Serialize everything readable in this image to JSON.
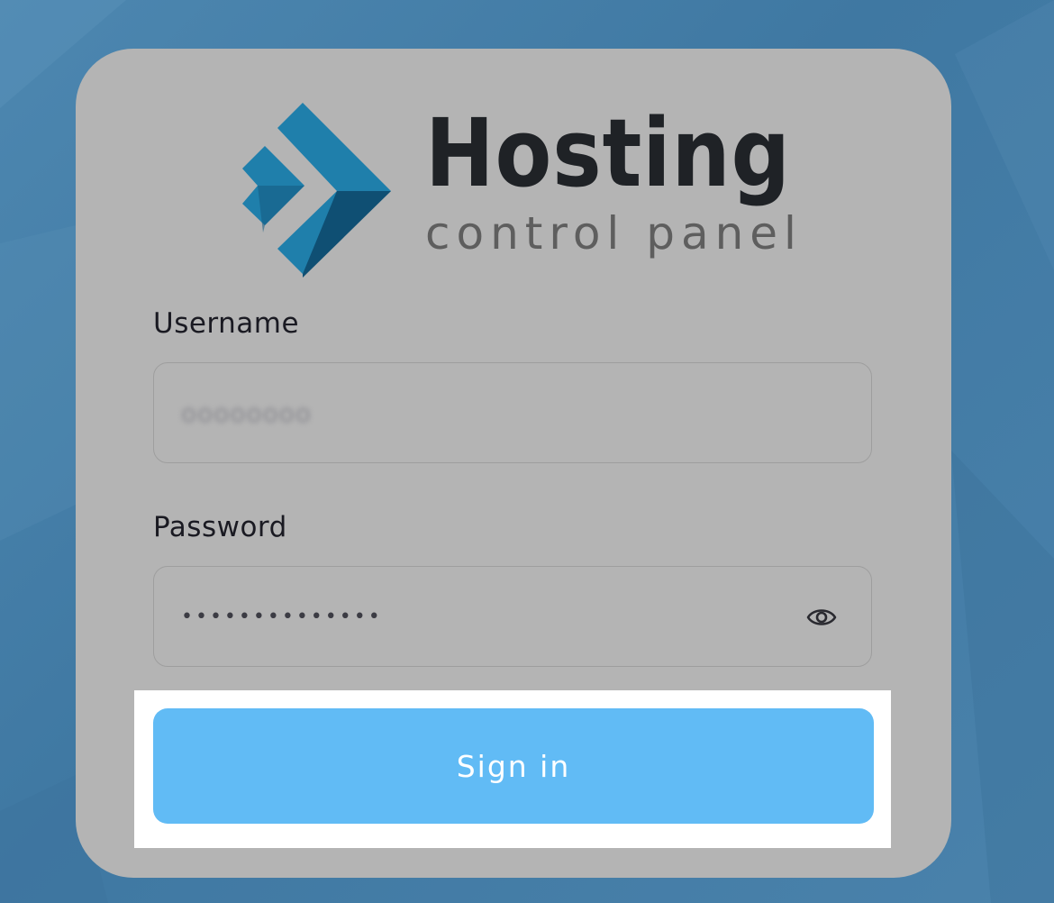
{
  "logo": {
    "title": "Hosting",
    "subtitle": "control panel"
  },
  "form": {
    "username": {
      "label": "Username",
      "value": "oooooooo"
    },
    "password": {
      "label": "Password",
      "value": "••••••••••••••",
      "toggle_icon": "eye-icon"
    },
    "submit_label": "Sign in"
  },
  "colors": {
    "background": "#4279a2",
    "card": "#b4b4b4",
    "button": "#61bbf5",
    "logo_blue": "#1f7fab",
    "logo_dark": "#155a80",
    "title_text": "#1f2226"
  }
}
